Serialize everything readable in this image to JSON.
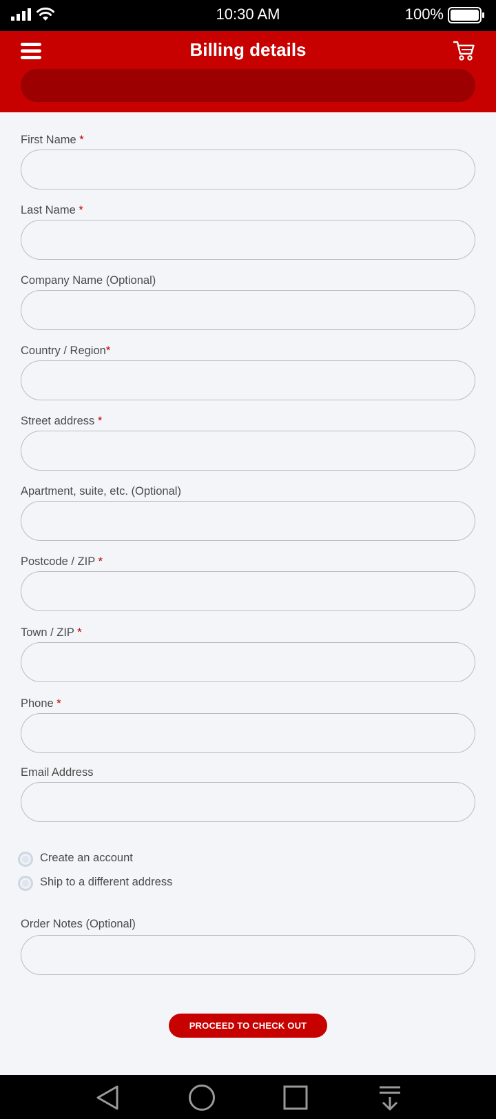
{
  "status_bar": {
    "time": "10:30 AM",
    "battery_percent": "100%",
    "icons": [
      "signal-icon",
      "wifi-icon",
      "battery-icon"
    ]
  },
  "header": {
    "title": "Billing details",
    "icons": [
      "menu-icon",
      "cart-icon"
    ],
    "colors": {
      "primary": "#c70000",
      "searchbar": "#9c0000"
    }
  },
  "form": {
    "fields": [
      {
        "label": "First Name",
        "required_mark": " *",
        "value": ""
      },
      {
        "label": "Last Name",
        "required_mark": " *",
        "value": ""
      },
      {
        "label": "Company Name (Optional)",
        "required_mark": "",
        "value": ""
      },
      {
        "label": "Country / Region",
        "required_mark": "*",
        "value": ""
      },
      {
        "label": "Street address",
        "required_mark": " *",
        "value": ""
      },
      {
        "label": "Apartment, suite, etc. (Optional)",
        "required_mark": "",
        "value": ""
      },
      {
        "label": "Postcode / ZIP",
        "required_mark": " *",
        "value": ""
      },
      {
        "label": "Town / ZIP",
        "required_mark": " *",
        "value": ""
      },
      {
        "label": "Phone",
        "required_mark": " *",
        "value": ""
      },
      {
        "label": "Email Address",
        "required_mark": "",
        "value": ""
      }
    ],
    "options": [
      {
        "label": "Create an account",
        "checked": false
      },
      {
        "label": "Ship to a different address",
        "checked": false
      }
    ],
    "notes": {
      "label": "Order Notes (Optional)",
      "value": ""
    },
    "submit_label": "PROCEED TO CHECK OUT"
  },
  "navbar": {
    "icons": [
      "back-icon",
      "home-icon",
      "recents-icon",
      "download-icon"
    ]
  }
}
